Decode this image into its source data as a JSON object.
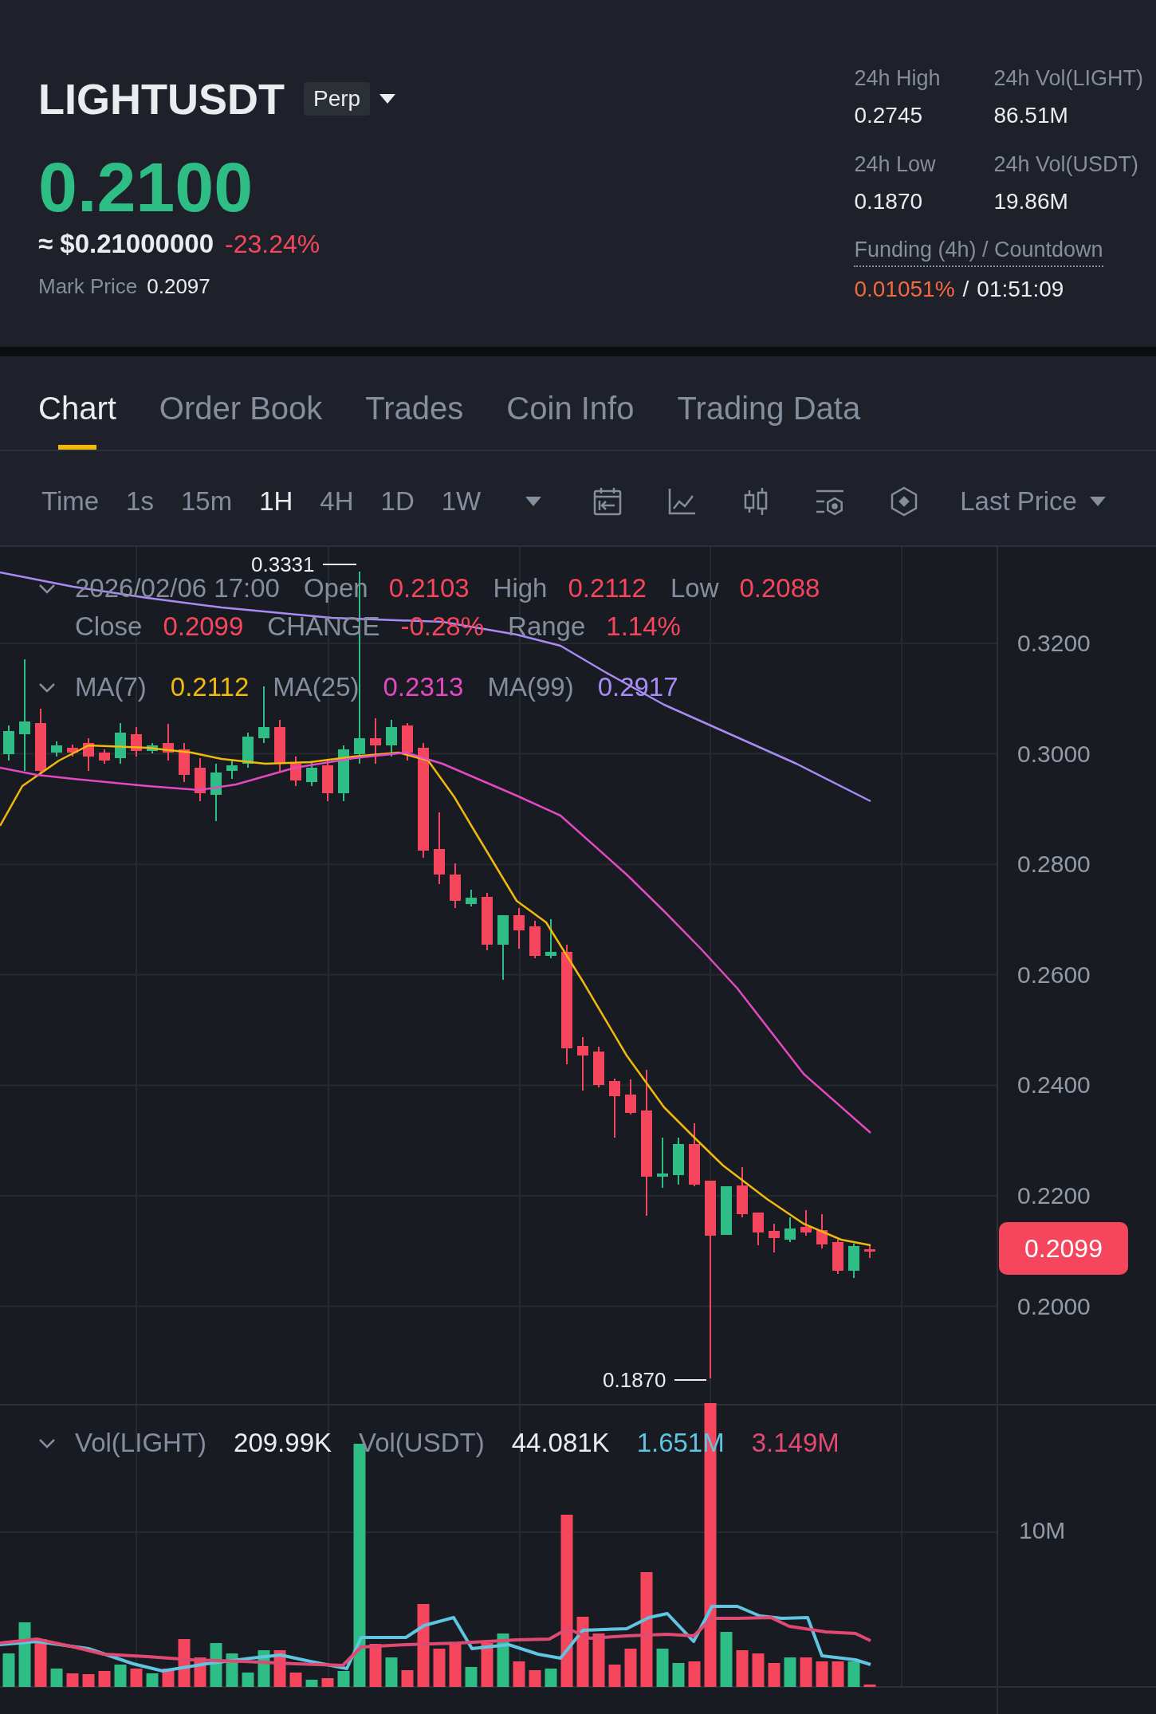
{
  "header": {
    "symbol": "LIGHTUSDT",
    "contract_badge": "Perp",
    "last_price": {
      "value": "0.2100",
      "rising": true
    },
    "fiat_price": "≈ $0.21000000",
    "change": {
      "value": "-23.24%",
      "rising": false
    },
    "mark_price": {
      "label": "Mark Price",
      "value": "0.2097"
    },
    "stats": [
      {
        "label": "24h High",
        "value": "0.2745"
      },
      {
        "label": "24h Vol(LIGHT)",
        "value": "86.51M"
      },
      {
        "label": "24h Low",
        "value": "0.1870"
      },
      {
        "label": "24h Vol(USDT)",
        "value": "19.86M"
      }
    ],
    "funding": {
      "label": "Funding (4h) / Countdown",
      "rate": "0.01051%",
      "separator": "/",
      "countdown": "01:51:09"
    }
  },
  "tabs": [
    {
      "label": "Chart",
      "selected": true
    },
    {
      "label": "Order Book",
      "selected": false
    },
    {
      "label": "Trades",
      "selected": false
    },
    {
      "label": "Coin Info",
      "selected": false
    },
    {
      "label": "Trading Data",
      "selected": false
    }
  ],
  "toolbar": {
    "intervals": [
      {
        "label": "Time",
        "selected": false
      },
      {
        "label": "1s",
        "selected": false
      },
      {
        "label": "15m",
        "selected": false
      },
      {
        "label": "1H",
        "selected": true
      },
      {
        "label": "4H",
        "selected": false
      },
      {
        "label": "1D",
        "selected": false
      },
      {
        "label": "1W",
        "selected": false
      }
    ],
    "price_type": "Last Price"
  },
  "chart": {
    "ohlc_legend": {
      "datetime": "2026/02/06 17:00",
      "rising": false,
      "fields": [
        {
          "label": "Open",
          "value": "0.2103"
        },
        {
          "label": "High",
          "value": "0.2112"
        },
        {
          "label": "Low",
          "value": "0.2088"
        },
        {
          "label": "Close",
          "value": "0.2099"
        },
        {
          "label": "CHANGE",
          "value": "-0.28%"
        },
        {
          "label": "Range",
          "value": "1.14%"
        }
      ]
    },
    "ma_legend": [
      {
        "label": "MA(7)",
        "value": "0.2112",
        "color": "#f0b90b"
      },
      {
        "label": "MA(25)",
        "value": "0.2313",
        "color": "#e449c3"
      },
      {
        "label": "MA(99)",
        "value": "0.2917",
        "color": "#a98bf5"
      }
    ],
    "high_marker": "0.3331",
    "low_marker": "0.1870",
    "price_axis": [
      "0.3200",
      "0.3000",
      "0.2800",
      "0.2600",
      "0.2400",
      "0.2200",
      "0.2000"
    ],
    "current_price_tag": {
      "value": "0.2099",
      "rising": false
    },
    "volume_legend": {
      "fields": [
        {
          "label": "Vol(LIGHT)",
          "value": "209.99K"
        },
        {
          "label": "Vol(USDT)",
          "value": "44.081K"
        }
      ],
      "averages": [
        {
          "value": "1.651M",
          "color": "#5fc5e0"
        },
        {
          "value": "3.149M",
          "color": "#e04a72"
        }
      ]
    },
    "volume_axis": [
      "10M"
    ]
  }
}
